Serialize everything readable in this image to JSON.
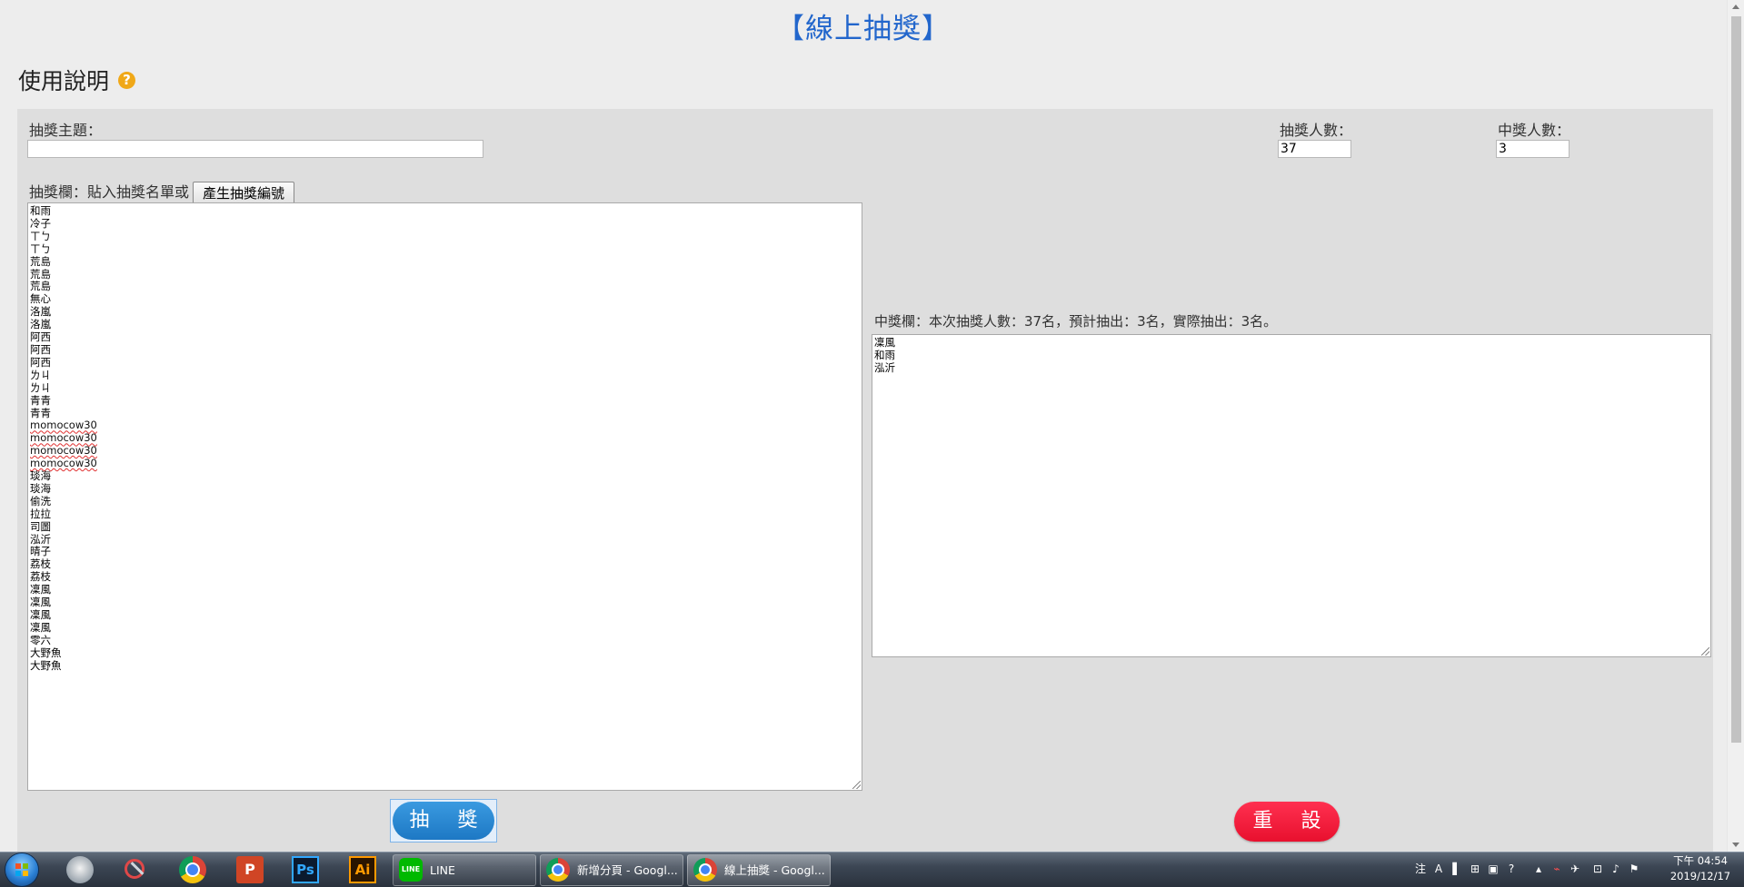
{
  "page": {
    "title": "【線上抽獎】",
    "usage_label": "使用說明",
    "help_icon_glyph": "?"
  },
  "form": {
    "topic_label": "抽獎主題：",
    "topic_value": "",
    "participants_label": "抽獎人數：",
    "participants_value": "37",
    "winners_label": "中獎人數：",
    "winners_value": "3",
    "entry_label": "抽獎欄：貼入抽獎名單或",
    "generate_button": "產生抽獎編號"
  },
  "entries": [
    "和雨",
    "冷子",
    "ㄒㄅ",
    "ㄒㄅ",
    "荒島",
    "荒島",
    "荒島",
    "無心",
    "洛嵐",
    "洛嵐",
    "阿西",
    "阿西",
    "阿西",
    "ㄌㄐ",
    "ㄌㄐ",
    "青青",
    "青青",
    "momocow30",
    "momocow30",
    "momocow30",
    "momocow30",
    "琰海",
    "琰海",
    "偷洗",
    "拉拉",
    "司圖",
    "泓沂",
    "晴子",
    "荔枝",
    "荔枝",
    "凜風",
    "凜風",
    "凜風",
    "凜風",
    "零六",
    "大野魚",
    "大野魚"
  ],
  "result": {
    "label": "中獎欄：本次抽獎人數：37名，預計抽出：3名，實際抽出：3名。",
    "winners": [
      "凜風",
      "和雨",
      "泓沂"
    ]
  },
  "buttons": {
    "draw": "抽 獎",
    "reset": "重 設"
  },
  "taskbar": {
    "pinned": [
      "windows-start",
      "cat-app",
      "snipping-tool",
      "chrome",
      "powerpoint",
      "photoshop",
      "illustrator"
    ],
    "ppt_glyph": "P",
    "ps_glyph": "Ps",
    "ai_glyph": "Ai",
    "line_icon_text": "LINE",
    "tasks": [
      {
        "label": "LINE"
      },
      {
        "label": "新增分頁 - Googl..."
      },
      {
        "label": "線上抽獎 - Googl..."
      }
    ],
    "tray_glyphs": [
      "注",
      "A",
      "▌",
      "⊞",
      "▣",
      "?",
      "▴",
      "⌁",
      "✈",
      "⊡",
      "♪",
      "⚑"
    ],
    "time": "下午 04:54",
    "date": "2019/12/17"
  },
  "colors": {
    "title": "#2266cc",
    "draw_button": "#1d78c4",
    "reset_button": "#e8102e",
    "help_icon": "#f0a818"
  }
}
